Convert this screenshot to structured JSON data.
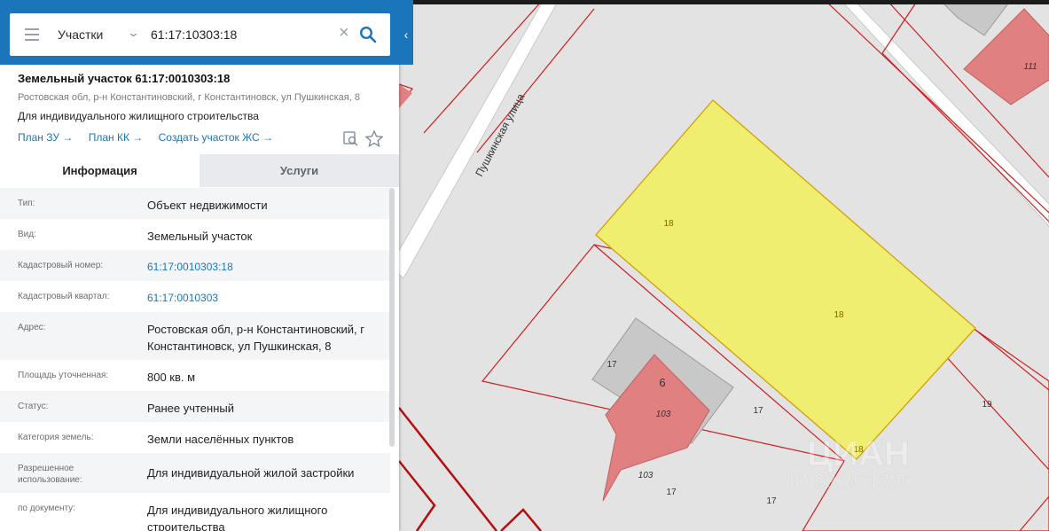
{
  "search": {
    "layer": "Участки",
    "query": "61:17:10303:18"
  },
  "parcel": {
    "title": "Земельный участок 61:17:0010303:18",
    "address": "Ростовская обл, р-н Константиновский, г Константиновск, ул Пушкинская, 8",
    "purpose": "Для индивидуального жилищного строительства",
    "links": [
      "План ЗУ →",
      "План КК →",
      "Создать участок ЖС →"
    ]
  },
  "tabs": [
    "Информация",
    "Услуги"
  ],
  "info_rows": [
    {
      "k": "Тип:",
      "v": "Объект недвижимости"
    },
    {
      "k": "Вид:",
      "v": "Земельный участок"
    },
    {
      "k": "Кадастровый номер:",
      "v": "61:17:0010303:18"
    },
    {
      "k": "Кадастровый квартал:",
      "v": "61:17:0010303"
    },
    {
      "k": "Адрес:",
      "v": "Ростовская обл, р-н Константиновский, г Константиновск, ул Пушкинская, 8"
    },
    {
      "k": "Площадь уточненная:",
      "v": "800 кв. м"
    },
    {
      "k": "Статус:",
      "v": "Ранее учтенный"
    },
    {
      "k": "Категория земель:",
      "v": "Земли населённых пунктов"
    },
    {
      "k": "Разрешенное использование:",
      "v": "Для индивидуальной жилой застройки"
    },
    {
      "k": "по документу:",
      "v": "Для индивидуального жилищного строительства"
    }
  ],
  "map": {
    "street": "Пушкинская улица",
    "labels": [
      "18",
      "18",
      "18",
      "17",
      "17",
      "17",
      "17",
      "19",
      "6",
      "103",
      "103",
      "111"
    ],
    "watermark": "ЦИАН",
    "watermark_id": "ID 291971285"
  },
  "icons": {
    "menu": "menu-icon",
    "chevron": "chevron-down-icon",
    "clear": "close-icon",
    "search": "search-icon",
    "collapse": "chevron-left-icon",
    "preview": "magnify-document-icon",
    "favorite": "star-icon"
  },
  "colors": {
    "header": "#1b75bb",
    "link": "#1b75bb",
    "selected_parcel": "#f0ee70",
    "parcel_border": "#cc1111",
    "building": "#e08080"
  }
}
